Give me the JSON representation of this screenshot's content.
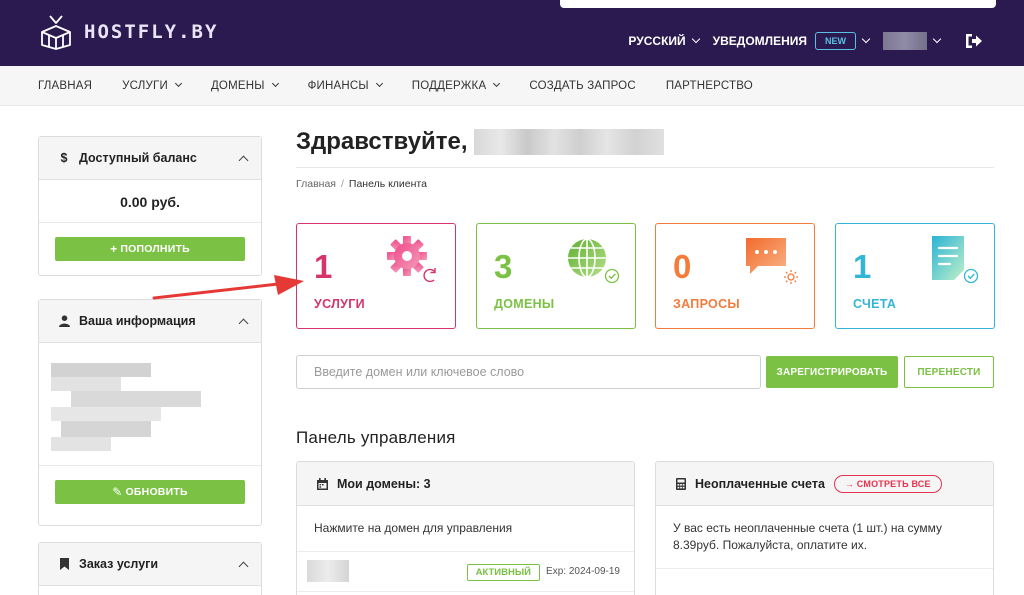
{
  "brand": {
    "name": "HOSTFLY.BY"
  },
  "header": {
    "language": "РУССКИЙ",
    "notifications": "УВЕДОМЛЕНИЯ",
    "new_badge": "NEW"
  },
  "nav": {
    "items": [
      {
        "label": "ГЛАВНАЯ",
        "dropdown": false
      },
      {
        "label": "УСЛУГИ",
        "dropdown": true
      },
      {
        "label": "ДОМЕНЫ",
        "dropdown": true
      },
      {
        "label": "ФИНАНСЫ",
        "dropdown": true
      },
      {
        "label": "ПОДДЕРЖКА",
        "dropdown": true
      },
      {
        "label": "СОЗДАТЬ ЗАПРОС",
        "dropdown": false
      },
      {
        "label": "ПАРТНЕРСТВО",
        "dropdown": false
      }
    ]
  },
  "sidebar": {
    "balance": {
      "title": "Доступный баланс",
      "value": "0.00 руб.",
      "button": "ПОПОЛНИТЬ",
      "icon": "dollar-icon"
    },
    "info": {
      "title": "Ваша информация",
      "button": "ОБНОВИТЬ",
      "icon": "user-icon"
    },
    "order": {
      "title": "Заказ услуги",
      "icon": "bookmark-icon"
    }
  },
  "main": {
    "greeting": "Здравствуйте,",
    "breadcrumb": {
      "home": "Главная",
      "separator": "/",
      "current": "Панель клиента"
    },
    "tiles": [
      {
        "count": "1",
        "label": "УСЛУГИ",
        "color": "#d6336c",
        "icon": "gear-refresh-icon"
      },
      {
        "count": "3",
        "label": "ДОМЕНЫ",
        "color": "#7ac144",
        "icon": "globe-check-icon"
      },
      {
        "count": "0",
        "label": "ЗАПРОСЫ",
        "color": "#f47b3a",
        "icon": "chat-gear-icon"
      },
      {
        "count": "1",
        "label": "СЧЕТА",
        "color": "#33b5d8",
        "icon": "document-check-icon"
      }
    ],
    "search": {
      "placeholder": "Введите домен или ключевое слово",
      "register_button": "ЗАРЕГИСТРИРОВАТЬ",
      "transfer_button": "ПЕРЕНЕСТИ"
    },
    "dashboard_title": "Панель управления",
    "domains_card": {
      "title": "Мои домены: 3",
      "hint": "Нажмите на домен для управления",
      "rows": [
        {
          "status": "АКТИВНЫЙ",
          "expiry": "Exp: 2024-09-19"
        }
      ]
    },
    "invoices_card": {
      "title": "Неоплаченные счета",
      "see_all": "→ СМОТРЕТЬ ВСЕ",
      "message": "У вас есть неоплаченные счета (1 шт.) на сумму 8.39руб. Пожалуйста, оплатите их."
    }
  },
  "colors": {
    "header_bg": "#2b1a4f",
    "green": "#7ac144",
    "pink": "#d6336c",
    "orange": "#f47b3a",
    "cyan": "#33b5d8",
    "arrow": "#e53935"
  }
}
